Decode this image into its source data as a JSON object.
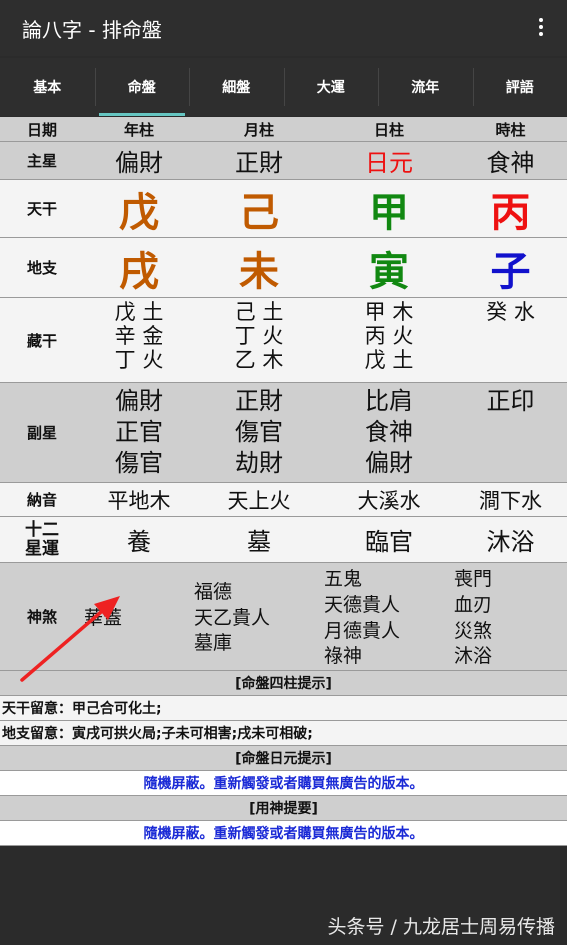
{
  "appbar": {
    "title": "論八字 - 排命盤",
    "menu_icon": "more-vert-icon"
  },
  "tabs": [
    "基本",
    "命盤",
    "細盤",
    "大運",
    "流年",
    "評語"
  ],
  "table": {
    "header": [
      "日期",
      "年柱",
      "月柱",
      "日柱",
      "時柱"
    ],
    "zhuxing": {
      "label": "主星",
      "values": [
        "偏財",
        "正財",
        "日元",
        "食神"
      ]
    },
    "tiangan": {
      "label": "天干",
      "values": [
        "戊",
        "己",
        "甲",
        "丙"
      ]
    },
    "dizhi": {
      "label": "地支",
      "values": [
        "戌",
        "未",
        "寅",
        "子"
      ]
    },
    "canggan": {
      "label": "藏干",
      "values": [
        [
          "戊 土",
          "辛 金",
          "丁 火"
        ],
        [
          "己 土",
          "丁 火",
          "乙 木"
        ],
        [
          "甲 木",
          "丙 火",
          "戊 土"
        ],
        [
          "癸 水"
        ]
      ]
    },
    "fuxing": {
      "label": "副星",
      "values": [
        [
          "偏財",
          "正官",
          "傷官"
        ],
        [
          "正財",
          "傷官",
          "劫財"
        ],
        [
          "比肩",
          "食神",
          "偏財"
        ],
        [
          "正印"
        ]
      ]
    },
    "nayin": {
      "label": "納音",
      "values": [
        "平地木",
        "天上火",
        "大溪水",
        "澗下水"
      ]
    },
    "yun": {
      "label_top": "十二",
      "label_bottom": "星運",
      "values": [
        "養",
        "墓",
        "臨官",
        "沐浴"
      ]
    },
    "shensha": {
      "label": "神煞",
      "values": [
        [
          "華蓋"
        ],
        [
          "福德",
          "天乙貴人",
          "墓庫"
        ],
        [
          "五鬼",
          "天德貴人",
          "月德貴人",
          "祿神"
        ],
        [
          "喪門",
          "血刃",
          "災煞",
          "沐浴"
        ]
      ]
    }
  },
  "tips": {
    "sizhu_title": "[命盤四柱提示]",
    "tiangan_note": "天干留意：甲己合可化土;",
    "dizhi_note": "地支留意：寅戌可拱火局;子未可相害;戌未可相破;",
    "riyuan_title": "[命盤日元提示]",
    "riyuan_notice": "隨機屏蔽。重新觸發或者購買無廣告的版本。",
    "yongshen_title": "[用神提要]",
    "yongshen_notice": "隨機屏蔽。重新觸發或者購買無廣告的版本。"
  },
  "footer": {
    "watermark": "头条号 / 九龙居士周易传播"
  },
  "colors": {
    "accent": "#66c6c2",
    "orange": "#c05a00",
    "red": "#ee1111",
    "green": "#118811",
    "blue": "#1111cc",
    "notice": "#1a2ad6"
  }
}
